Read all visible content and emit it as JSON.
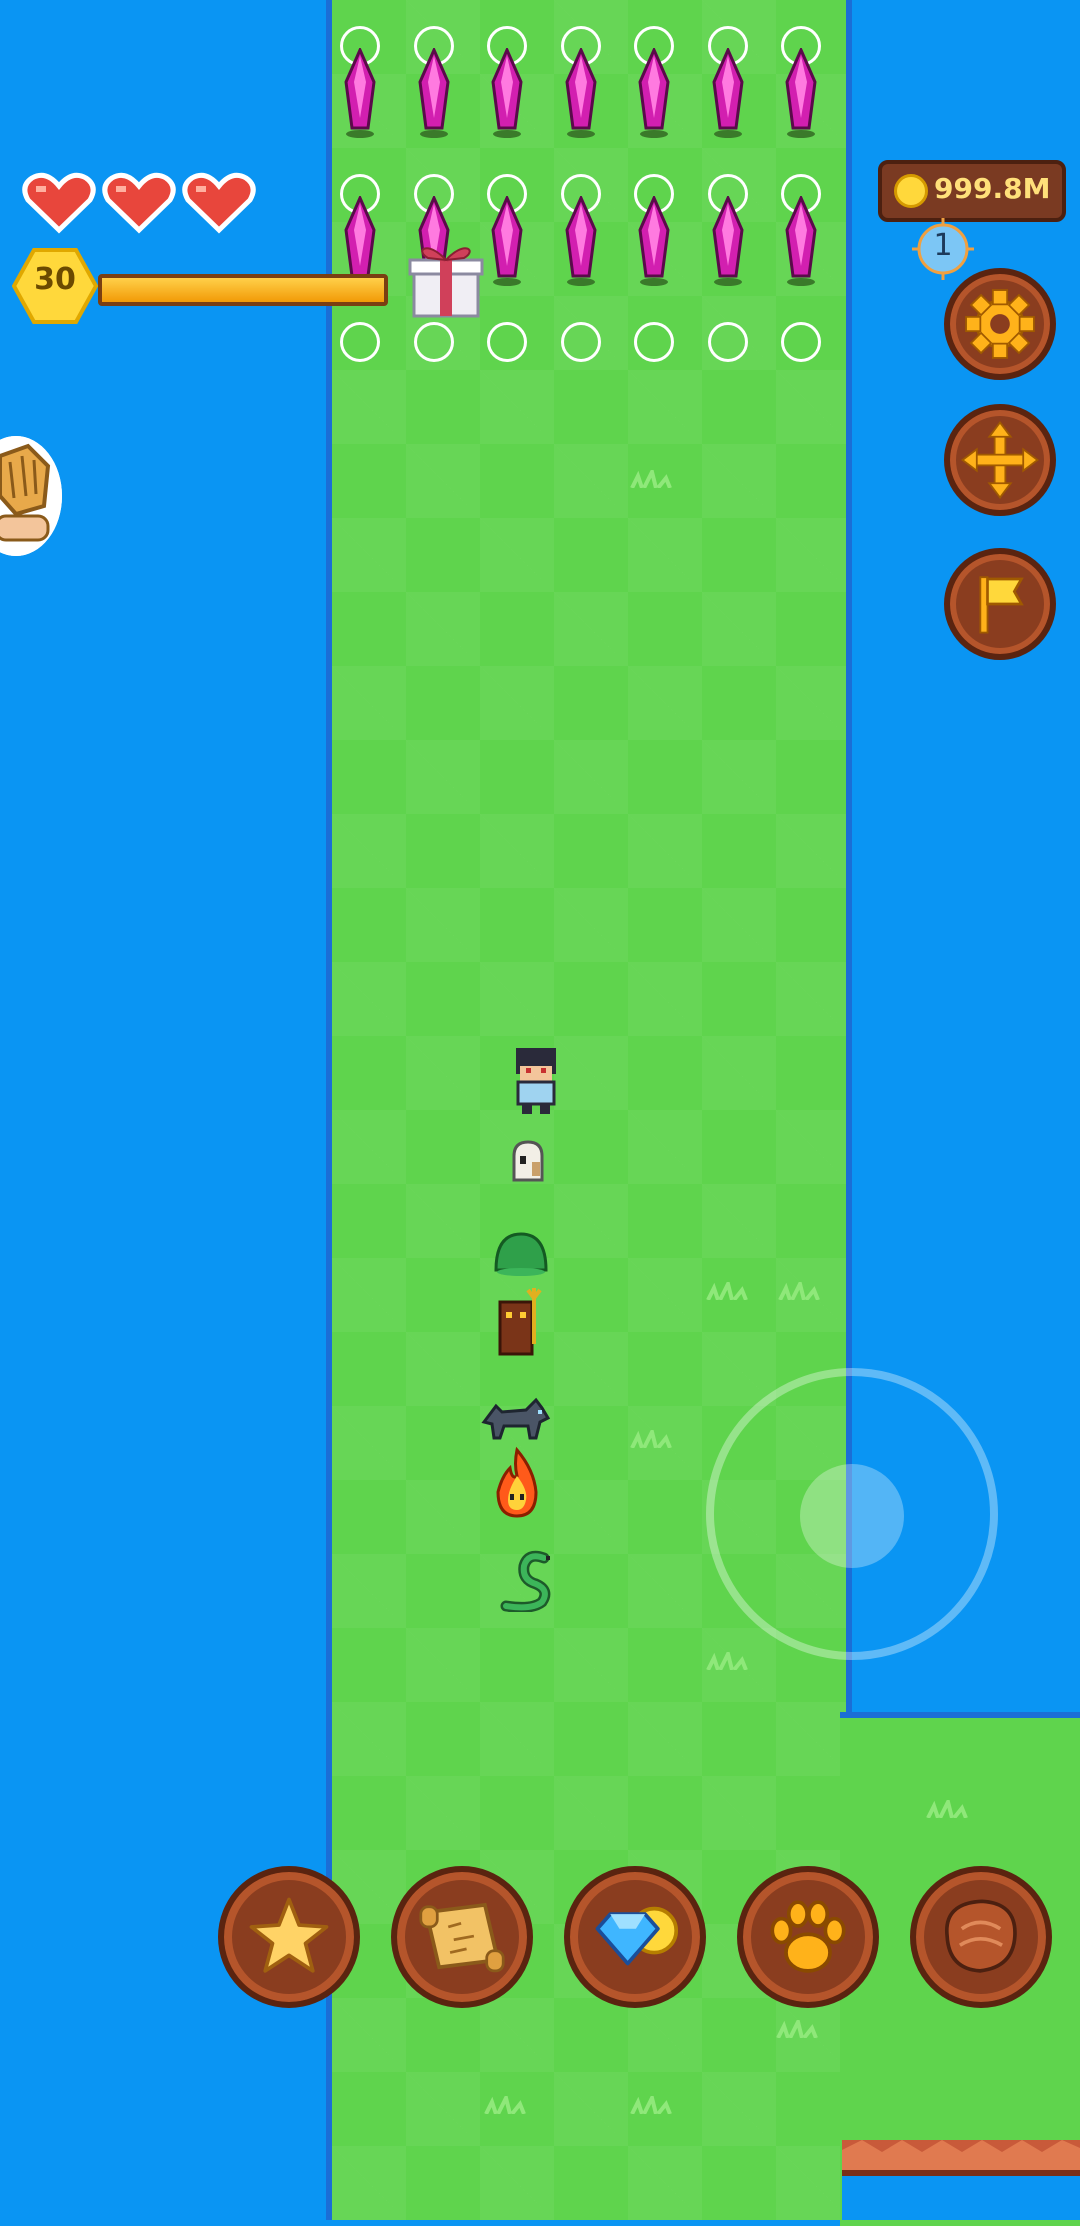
{
  "hud": {
    "hearts": [
      {
        "name": "heart-icon",
        "state": "full"
      },
      {
        "name": "heart-icon",
        "state": "full"
      },
      {
        "name": "heart-icon",
        "state": "full"
      }
    ],
    "level": "30",
    "xp_fraction": 1.0,
    "coins": "999.8M",
    "marker_number": "1"
  },
  "side_buttons": [
    {
      "name": "settings-button",
      "icon": "gear-icon"
    },
    {
      "name": "move-button",
      "icon": "move-arrows-icon"
    },
    {
      "name": "flag-button",
      "icon": "flag-icon"
    }
  ],
  "bottom_bar": [
    {
      "name": "star-button",
      "icon": "star-icon"
    },
    {
      "name": "map-button",
      "icon": "scroll-map-icon"
    },
    {
      "name": "shop-button",
      "icon": "gem-coin-icon"
    },
    {
      "name": "pets-button",
      "icon": "paw-icon"
    },
    {
      "name": "meat-button",
      "icon": "meat-icon"
    }
  ],
  "colors": {
    "water": "#0a95f3",
    "grass": "#5fd44d",
    "button_wood": "#8a3d1f",
    "crystal": "#d21fb0",
    "heart": "#e8463c",
    "gold": "#ffd83b"
  },
  "world": {
    "crystal_columns": 7,
    "crystal_rows": 2,
    "party": [
      "hero",
      "ghost-pet",
      "slime-pet",
      "imp-pet",
      "wolf-pet",
      "fire-spirit-pet",
      "snake-pet"
    ]
  }
}
